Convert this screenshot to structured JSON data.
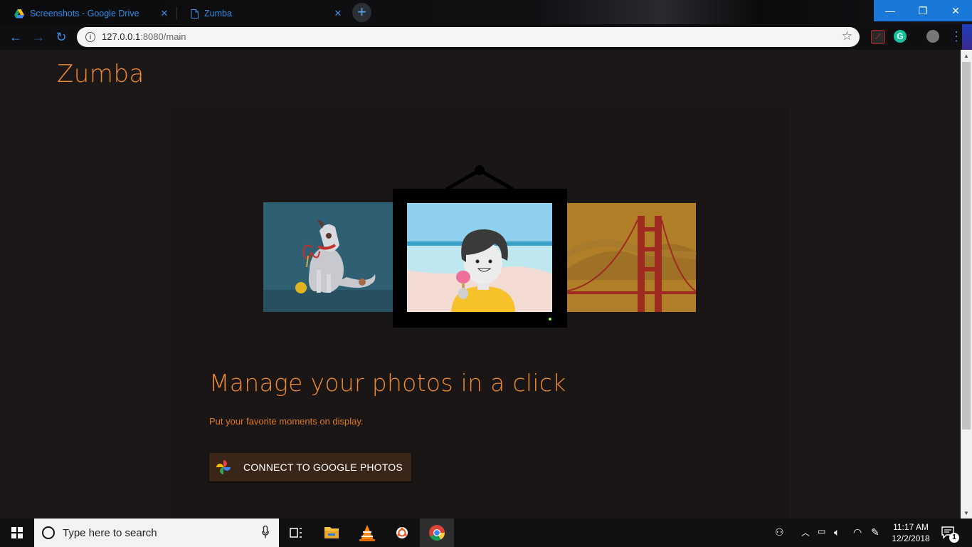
{
  "browser": {
    "tabs": [
      {
        "title": "Screenshots - Google Drive",
        "icon": "google-drive-icon"
      },
      {
        "title": "Zumba",
        "icon": "page-icon",
        "active": true
      }
    ],
    "address": {
      "host": "127.0.0.1",
      "path": ":8080/main"
    },
    "accent_color": "#1a78d8"
  },
  "page": {
    "app_title": "Zumba",
    "headline": "Manage your photos in a click",
    "subline": "Put your favorite moments on display.",
    "connect_button": "CONNECT TO GOOGLE PHOTOS",
    "accent_color": "#f08a2e"
  },
  "taskbar": {
    "search_placeholder": "Type here to search",
    "time": "11:17 AM",
    "date": "12/2/2018",
    "notification_count": "1",
    "apps": [
      "task-view-icon",
      "file-explorer-icon",
      "vlc-icon",
      "ubuntu-icon",
      "chrome-icon"
    ]
  }
}
